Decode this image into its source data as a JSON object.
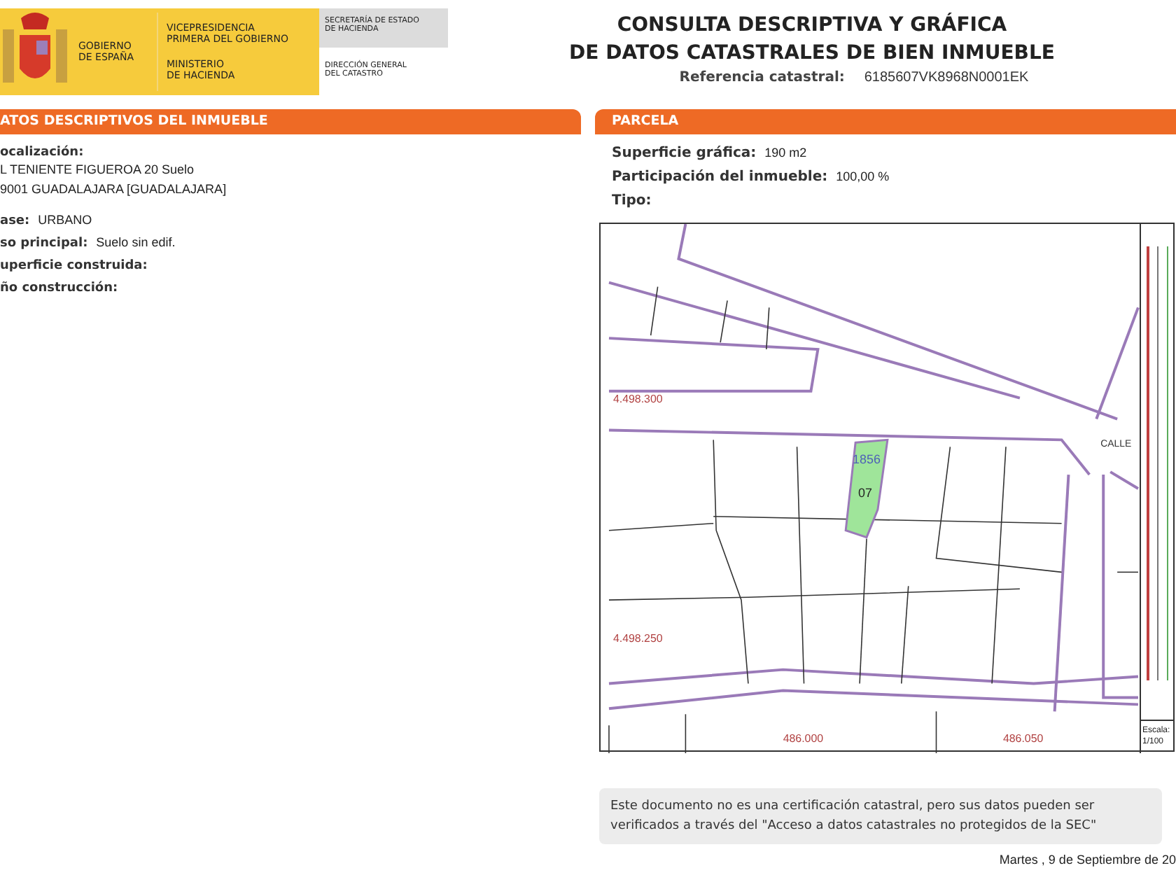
{
  "header": {
    "gov": [
      "GOBIERNO",
      "DE ESPAÑA"
    ],
    "vice": [
      "VICEPRESIDENCIA",
      "PRIMERA DEL GOBIERNO"
    ],
    "ministry": [
      "MINISTERIO",
      "DE HACIENDA"
    ],
    "secretary": [
      "SECRETARÍA DE ESTADO",
      "DE HACIENDA"
    ],
    "direction": [
      "DIRECCIÓN GENERAL",
      "DEL CATASTRO"
    ],
    "title": [
      "CONSULTA DESCRIPTIVA Y GRÁFICA",
      "DE DATOS CATASTRALES DE BIEN INMUEBLE"
    ],
    "reference_label": "Referencia catastral:",
    "reference_value": "6185607VK8968N0001EK"
  },
  "left_panel": {
    "title": "ATOS DESCRIPTIVOS DEL INMUEBLE",
    "location_label": "ocalización:",
    "address": [
      "L TENIENTE FIGUEROA 20 Suelo",
      "9001 GUADALAJARA [GUADALAJARA]"
    ],
    "fields": [
      {
        "label": "ase:",
        "value": "URBANO"
      },
      {
        "label": "so principal:",
        "value": "Suelo sin edif."
      },
      {
        "label": "uperficie construida:"
      },
      {
        "label": "ño construcción:"
      }
    ]
  },
  "right_panel": {
    "title": "PARCELA",
    "fields": [
      {
        "label": "Superficie gráfica:",
        "value": "190 m2"
      },
      {
        "label": "Participación del inmueble:",
        "value": "100,00 %"
      },
      {
        "label": "Tipo:"
      }
    ]
  },
  "map": {
    "labels": [
      "4.498.300",
      "4.498.250",
      "1856",
      "07",
      "486.000",
      "486.050",
      "CALLE"
    ],
    "scale_label": "Escala:",
    "scale_value": "1/100"
  },
  "notice": "Este documento no es una certificación catastral, pero sus datos pueden ser verificados a través del \"Acceso a datos catastrales no protegidos de la SEC\"",
  "date": "Martes , 9 de Septiembre de 20"
}
